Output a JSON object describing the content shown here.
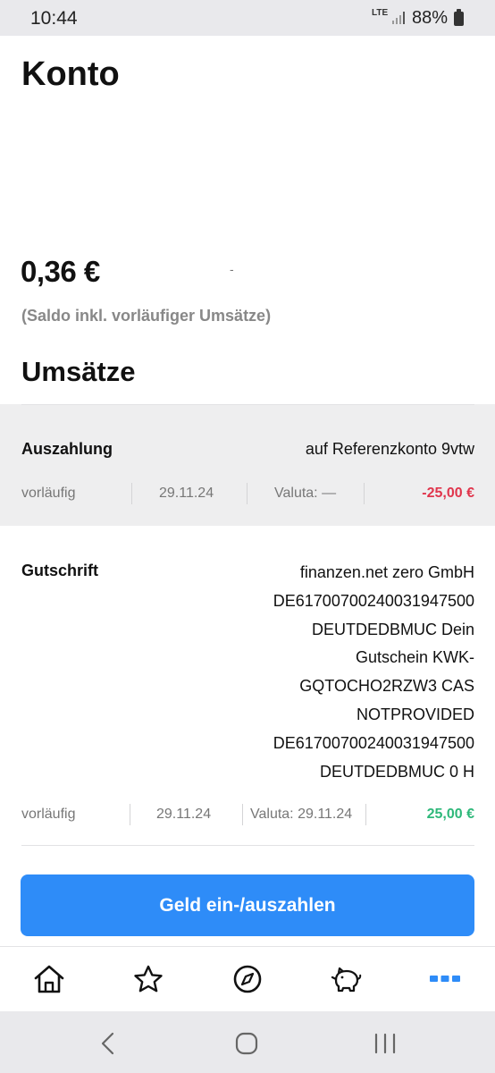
{
  "status_bar": {
    "time": "10:44",
    "network": "LTE",
    "battery": "88%"
  },
  "header": {
    "title": "Konto"
  },
  "balance": {
    "amount": "0,36 €",
    "dash": "-",
    "note": "(Saldo inkl. vorläufiger Umsätze)"
  },
  "transactions_section": {
    "title": "Umsätze"
  },
  "transactions": [
    {
      "type": "Auszahlung",
      "description": "auf Referenzkonto 9vtw",
      "status": "vorläufig",
      "date": "29.11.24",
      "valuta": "Valuta: —",
      "amount": "-25,00 €"
    },
    {
      "type": "Gutschrift",
      "description_lines": [
        "finanzen.net zero GmbH",
        "DE61700700240031947500",
        "DEUTDEDBMUC Dein",
        "Gutschein KWK-",
        "GQTOCHO2RZW3 CAS",
        "NOTPROVIDED",
        "DE61700700240031947500",
        "DEUTDEDBMUC 0 H"
      ],
      "status": "vorläufig",
      "date": "29.11.24",
      "valuta": "Valuta: 29.11.24",
      "amount": "25,00 €"
    }
  ],
  "cta": {
    "label": "Geld ein-/auszahlen"
  },
  "colors": {
    "accent": "#2e8cf8",
    "negative": "#e0354c",
    "positive": "#2eb87a"
  },
  "bottom_nav": {
    "items": [
      {
        "icon": "home-icon"
      },
      {
        "icon": "star-icon"
      },
      {
        "icon": "compass-icon"
      },
      {
        "icon": "piggy-bank-icon"
      },
      {
        "icon": "more-icon",
        "active": true
      }
    ]
  },
  "system_nav": {
    "icons": [
      "back-icon",
      "home-circle-icon",
      "recents-icon"
    ]
  }
}
